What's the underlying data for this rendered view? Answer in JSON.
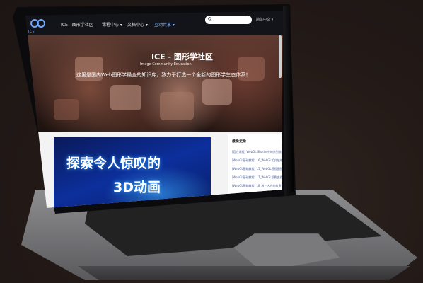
{
  "site": {
    "logo_text": "ICE",
    "nav": {
      "brand": "ICE - 图形学社区",
      "items": [
        {
          "label": "课程中心 ▾"
        },
        {
          "label": "文档中心 ▾"
        },
        {
          "label": "互动共享 ▾"
        }
      ],
      "search_placeholder": "",
      "language": "简体中文 ▾"
    },
    "hero": {
      "title": "ICE - 图形学社区",
      "subtitle": "Image Community Education",
      "description": "这里是国内Web图形学最全的知识库，致力于打造一个全新的图形学生态体系！"
    },
    "banner": {
      "line1": "探索令人惊叹的",
      "line2": "3D动画"
    },
    "sidebar": {
      "title": "最新更新",
      "items": [
        "[官方课程] WebGL Shader中的系列教程",
        "[WebGL基础教程] 16_WebGL相交放缩",
        "[WebGL基础教程] 15_WebGL透视图投",
        "[WebGL基础教程] 17_WebGL投影变换",
        "[WebGL基础教程] 18_着三大件的纹多"
      ]
    }
  },
  "colors": {
    "accent": "#7fb7ff",
    "nav_bg": "#12141a",
    "banner_blue": "#0c2f9c"
  }
}
